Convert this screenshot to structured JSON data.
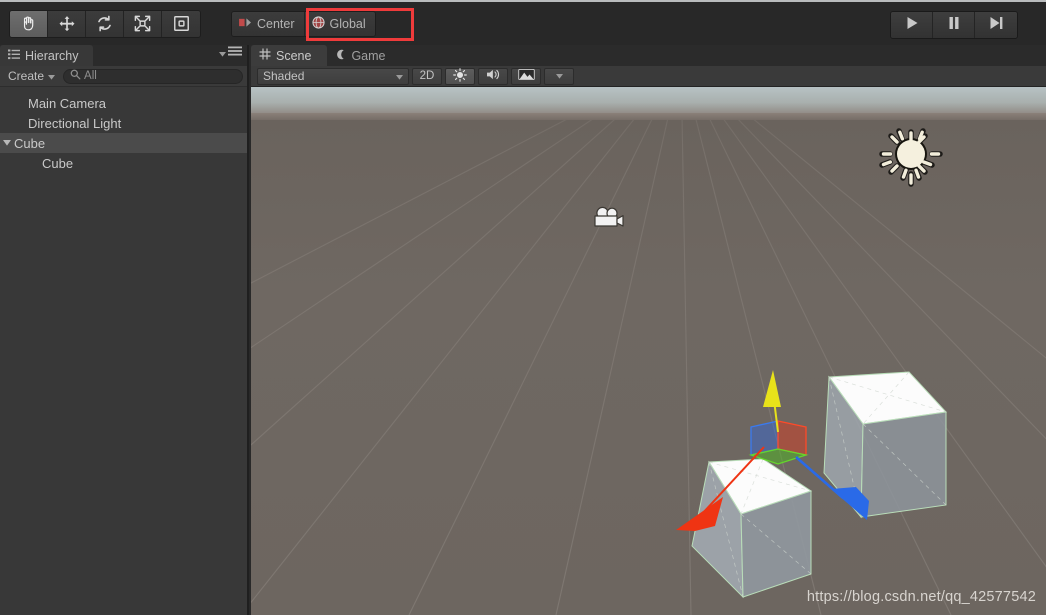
{
  "toolbar": {
    "tools": [
      {
        "name": "hand-tool",
        "icon": "hand-icon",
        "active": true
      },
      {
        "name": "move-tool",
        "icon": "move-icon",
        "active": false
      },
      {
        "name": "rotate-tool",
        "icon": "rotate-icon",
        "active": false
      },
      {
        "name": "scale-tool",
        "icon": "scale-icon",
        "active": false
      },
      {
        "name": "rect-transform-tool",
        "icon": "rect-icon",
        "active": false
      }
    ],
    "pivot_label": "Center",
    "space_label": "Global",
    "highlight_color": "#ef3b3b",
    "play_label": "Play",
    "pause_label": "Pause",
    "step_label": "Step"
  },
  "hierarchy": {
    "tab_label": "Hierarchy",
    "create_label": "Create",
    "search_value": "All",
    "search_placeholder": "All",
    "items": [
      {
        "label": "Main Camera",
        "indent": 1,
        "expandable": false,
        "selected": false
      },
      {
        "label": "Directional Light",
        "indent": 1,
        "expandable": false,
        "selected": false
      },
      {
        "label": "Cube",
        "indent": 0,
        "expandable": true,
        "selected": true
      },
      {
        "label": "Cube",
        "indent": 2,
        "expandable": false,
        "selected": false
      }
    ]
  },
  "scene": {
    "tabs": [
      {
        "label": "Scene",
        "icon": "grid-icon",
        "active": true
      },
      {
        "label": "Game",
        "icon": "gamepad-icon",
        "active": false
      }
    ],
    "draw_mode": "Shaded",
    "toggle_2d": "2D",
    "lighting_icon": "sun-icon",
    "audio_icon": "speaker-icon",
    "effects_icon": "image-icon",
    "effects_dropdown_icon": "chevron-down-icon",
    "gizmos": {
      "light_gizmo": "sun-icon",
      "camera_gizmo": "camera-icon"
    },
    "transform_gizmo": {
      "x_axis_color": "#ef3413",
      "y_axis_color": "#e8e21a",
      "z_axis_color": "#2a6ae8",
      "type": "move"
    },
    "watermark": "https://blog.csdn.net/qq_42577542"
  }
}
